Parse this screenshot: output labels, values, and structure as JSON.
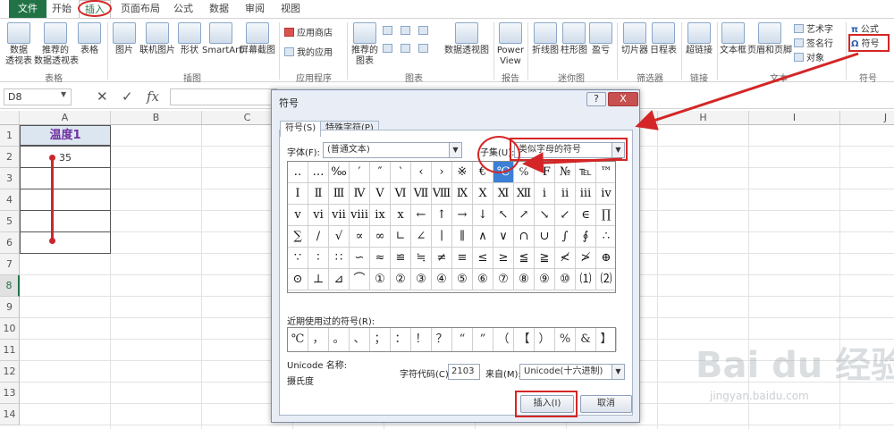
{
  "tabs": [
    {
      "label": "文件",
      "kind": "file"
    },
    {
      "label": "开始",
      "kind": "normal"
    },
    {
      "label": "插入",
      "kind": "active"
    },
    {
      "label": "页面布局",
      "kind": "normal"
    },
    {
      "label": "公式",
      "kind": "normal"
    },
    {
      "label": "数据",
      "kind": "normal"
    },
    {
      "label": "审阅",
      "kind": "normal"
    },
    {
      "label": "视图",
      "kind": "normal"
    }
  ],
  "ribbon": {
    "pivot_table": "数据\n透视表",
    "recommended_pivot": "推荐的\n数据透视表",
    "table": "表格",
    "group_tables": "表格",
    "picture": "图片",
    "online_picture": "联机图片",
    "shapes": "形状",
    "smartart": "SmartArt",
    "screenshot": "屏幕截图",
    "group_illustrations": "插图",
    "app_store": "应用商店",
    "my_apps": "我的应用",
    "group_apps": "应用程序",
    "recommended_charts": "推荐的\n图表",
    "pivot_chart": "数据透视图",
    "group_charts": "图表",
    "power_view": "Power\nView",
    "group_reports": "报告",
    "sparkline_line": "折线图",
    "sparkline_column": "柱形图",
    "sparkline_winloss": "盈亏",
    "group_sparklines": "迷你图",
    "slicer": "切片器",
    "timeline": "日程表",
    "group_filters": "筛选器",
    "hyperlink": "超链接",
    "group_links": "链接",
    "textbox": "文本框",
    "header_footer": "页眉和页脚",
    "wordart": "艺术字",
    "signature": "签名行",
    "object": "对象",
    "group_text": "文本",
    "equation": "公式",
    "symbol": "符号",
    "group_symbols": "符号"
  },
  "formula_bar": {
    "name_box": "D8",
    "fx": "fx"
  },
  "sheet": {
    "columns": [
      "A",
      "B",
      "C",
      "D",
      "E",
      "F",
      "G",
      "H",
      "I",
      "J"
    ],
    "rows": [
      "1",
      "2",
      "3",
      "4",
      "5",
      "6",
      "7",
      "8",
      "9",
      "10",
      "11",
      "12",
      "13",
      "14"
    ],
    "selected_row": "8",
    "a1": "温度1",
    "a2": "35"
  },
  "dialog": {
    "title": "符号",
    "help": "?",
    "close": "X",
    "tab_symbols": "符号(S)",
    "tab_special": "特殊字符(P)",
    "font_label": "字体(F):",
    "font_value": "(普通文本)",
    "subset_label": "子集(U):",
    "subset_value": "类似字母的符号",
    "symbols": [
      "‥",
      "…",
      "‰",
      "′",
      "″",
      "‵",
      "‹",
      "›",
      "※",
      "€",
      "℃",
      "℅",
      "℉",
      "№",
      "℡",
      "™",
      "Ⅰ",
      "Ⅱ",
      "Ⅲ",
      "Ⅳ",
      "Ⅴ",
      "Ⅵ",
      "Ⅶ",
      "Ⅷ",
      "Ⅸ",
      "Ⅹ",
      "Ⅺ",
      "Ⅻ",
      "ⅰ",
      "ⅱ",
      "ⅲ",
      "ⅳ",
      "ⅴ",
      "ⅵ",
      "ⅶ",
      "ⅷ",
      "ⅸ",
      "ⅹ",
      "←",
      "↑",
      "→",
      "↓",
      "↖",
      "↗",
      "↘",
      "↙",
      "∈",
      "∏",
      "∑",
      "∕",
      "√",
      "∝",
      "∞",
      "∟",
      "∠",
      "∣",
      "∥",
      "∧",
      "∨",
      "∩",
      "∪",
      "∫",
      "∮",
      "∴",
      "∵",
      "∶",
      "∷",
      "∽",
      "≈",
      "≌",
      "≒",
      "≠",
      "≡",
      "≤",
      "≥",
      "≦",
      "≧",
      "≮",
      "≯",
      "⊕",
      "⊙",
      "⊥",
      "⊿",
      "⌒",
      "①",
      "②",
      "③",
      "④",
      "⑤",
      "⑥",
      "⑦",
      "⑧",
      "⑨",
      "⑩",
      "⑴",
      "⑵"
    ],
    "selected_index": 10,
    "recent_label": "近期使用过的符号(R):",
    "recent": [
      "℃",
      "，",
      "。",
      "、",
      "；",
      "：",
      "！",
      "？",
      "“",
      "”",
      "（",
      "【",
      "）",
      "%",
      "&",
      "】"
    ],
    "unicode_name_label": "Unicode 名称:",
    "unicode_name": "摄氏度",
    "char_code_label": "字符代码(C):",
    "char_code": "2103",
    "from_label": "来自(M):",
    "from_value": "Unicode(十六进制)",
    "insert": "插入(I)",
    "cancel": "取消"
  },
  "watermark": {
    "brand": "Bai du 经验",
    "url": "jingyan.baidu.com"
  },
  "colors": {
    "excel_green": "#217346",
    "annotation_red": "#d42626",
    "selected_symbol": "#3b7fd6",
    "header_fill": "#dce6f1",
    "header_text": "#7030a0"
  }
}
